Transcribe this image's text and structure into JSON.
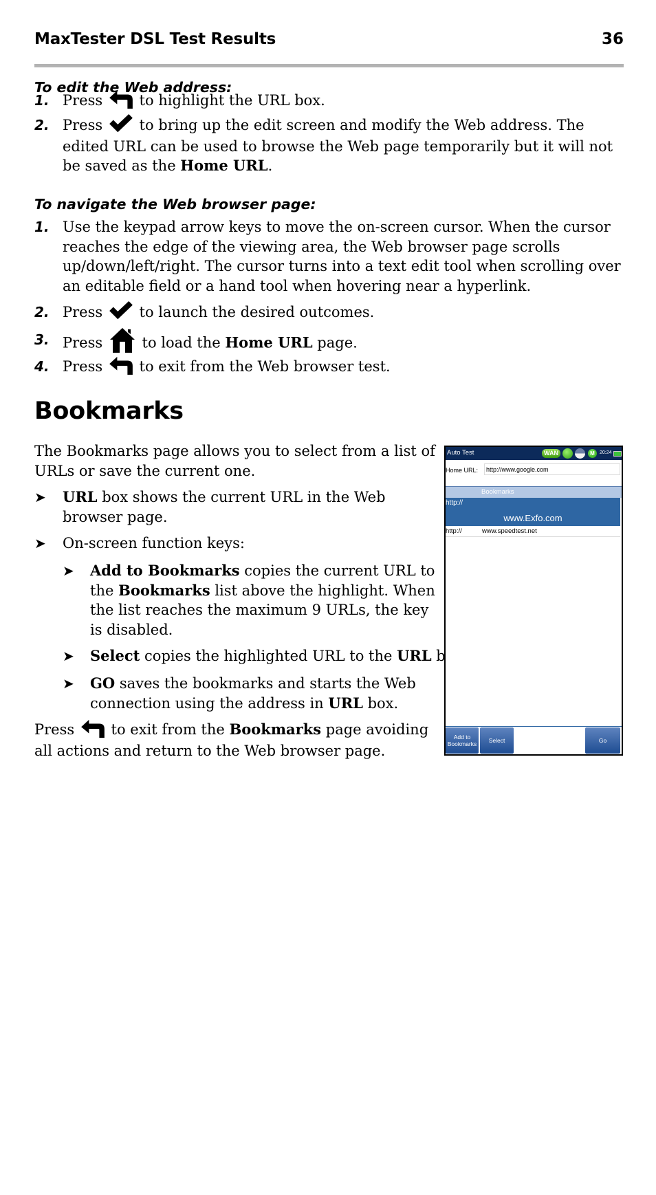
{
  "header": {
    "title": "MaxTester DSL Test Results",
    "page_number": "36"
  },
  "edit_section": {
    "title": "To edit the Web address:",
    "steps": [
      {
        "num": "1.",
        "pre": "Press",
        "icon": "back-arrow-icon",
        "post": " to highlight the URL box."
      },
      {
        "num": "2.",
        "pre": "Press",
        "icon": "checkmark-icon",
        "post": "  to bring up the edit screen and modify the Web address. The edited URL can be used to browse the Web page temporarily but it will not be saved as the ",
        "bold": "Home URL",
        "tail": "."
      }
    ]
  },
  "navigate_section": {
    "title": "To navigate the Web browser page:",
    "steps": [
      {
        "num": "1.",
        "text": "Use the keypad arrow keys to move the on-screen cursor. When the cursor reaches the edge of the viewing area, the Web browser page scrolls up/down/left/right. The cursor turns into a text edit tool when scrolling over an editable field or a hand tool when hovering near a hyperlink."
      },
      {
        "num": "2.",
        "pre": "Press",
        "icon": "checkmark-icon",
        "post": "  to launch the desired outcomes."
      },
      {
        "num": "3.",
        "pre": "Press",
        "icon": "home-icon",
        "post": " to load the ",
        "bold": "Home URL",
        "tail": " page."
      },
      {
        "num": "4.",
        "pre": "Press",
        "icon": "back-arrow-icon",
        "post": " to exit from the Web browser test."
      }
    ]
  },
  "bookmarks_section": {
    "heading": "Bookmarks",
    "intro": "The Bookmarks page allows you to select from a list of URLs or save the current one.",
    "bullets": [
      {
        "bold": "URL",
        "text": " box shows the current URL in the Web browser page."
      },
      {
        "text": "On-screen function keys:"
      }
    ],
    "sub_bullets": [
      {
        "bold": "Add to Bookmarks",
        "text": " copies the current URL to the ",
        "bold2": "Bookmarks",
        "text2": " list above the highlight. When the list reaches the maximum 9 URLs, the key is disabled."
      },
      {
        "bold": "Select",
        "text": " copies the highlighted URL to the ",
        "bold2": "URL",
        "text2": " box."
      },
      {
        "bold": "GO",
        "text": " saves the bookmarks and starts the Web connection using the address in ",
        "bold2": "URL",
        "text2": " box."
      }
    ],
    "footer": {
      "pre": "Press",
      "icon": "back-arrow-icon",
      "post": " to exit from the ",
      "bold": "Bookmarks",
      "tail": " page avoiding all actions and return to the Web browser page."
    },
    "arrow_glyph": "➤"
  },
  "device_screen": {
    "title": "Auto Test",
    "status": {
      "wan": "WAN",
      "m_badge": "M",
      "clock": "20:24"
    },
    "home_url_label": "Home URL:",
    "home_url_value": "http://www.google.com",
    "list_header": "Bookmarks",
    "bookmarks": [
      {
        "prefix": "http://",
        "url": "www.Exfo.com",
        "selected": true
      },
      {
        "prefix": "http://",
        "url": "www.speedtest.net",
        "selected": false
      }
    ],
    "function_keys": {
      "add": "Add to Bookmarks",
      "select": "Select",
      "go": "Go"
    },
    "colors": {
      "title_bar": "#0c2a5a",
      "selection": "#2e66a3",
      "list_header": "#b4c8e4"
    }
  }
}
